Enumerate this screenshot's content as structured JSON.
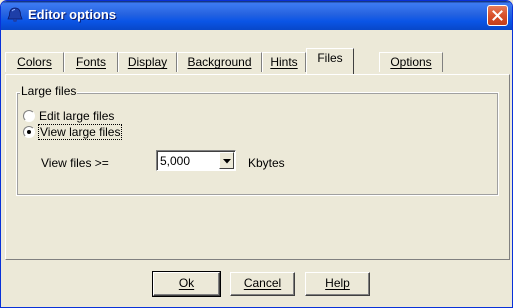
{
  "window": {
    "title": "Editor options"
  },
  "tabs": [
    {
      "label": "Colors"
    },
    {
      "label": "Fonts"
    },
    {
      "label": "Display"
    },
    {
      "label": "Background"
    },
    {
      "label": "Hints"
    },
    {
      "label": "Files"
    },
    {
      "label": "Options"
    }
  ],
  "selected_tab": "Files",
  "group": {
    "title": "Large files",
    "options": [
      {
        "label": "Edit large files",
        "selected": false
      },
      {
        "label": "View large files",
        "selected": true
      }
    ],
    "view_files_label": "View files >=",
    "view_files_value": "5,000",
    "unit_label": "Kbytes"
  },
  "buttons": {
    "ok": "Ok",
    "cancel": "Cancel",
    "help": "Help"
  },
  "colors": {
    "titlebar": "#0a55e6",
    "face": "#ece9d8",
    "close_button": "#d9512b"
  },
  "icons": {
    "app": "bell-app-icon",
    "close": "close-icon",
    "dropdown": "chevron-down-icon"
  }
}
